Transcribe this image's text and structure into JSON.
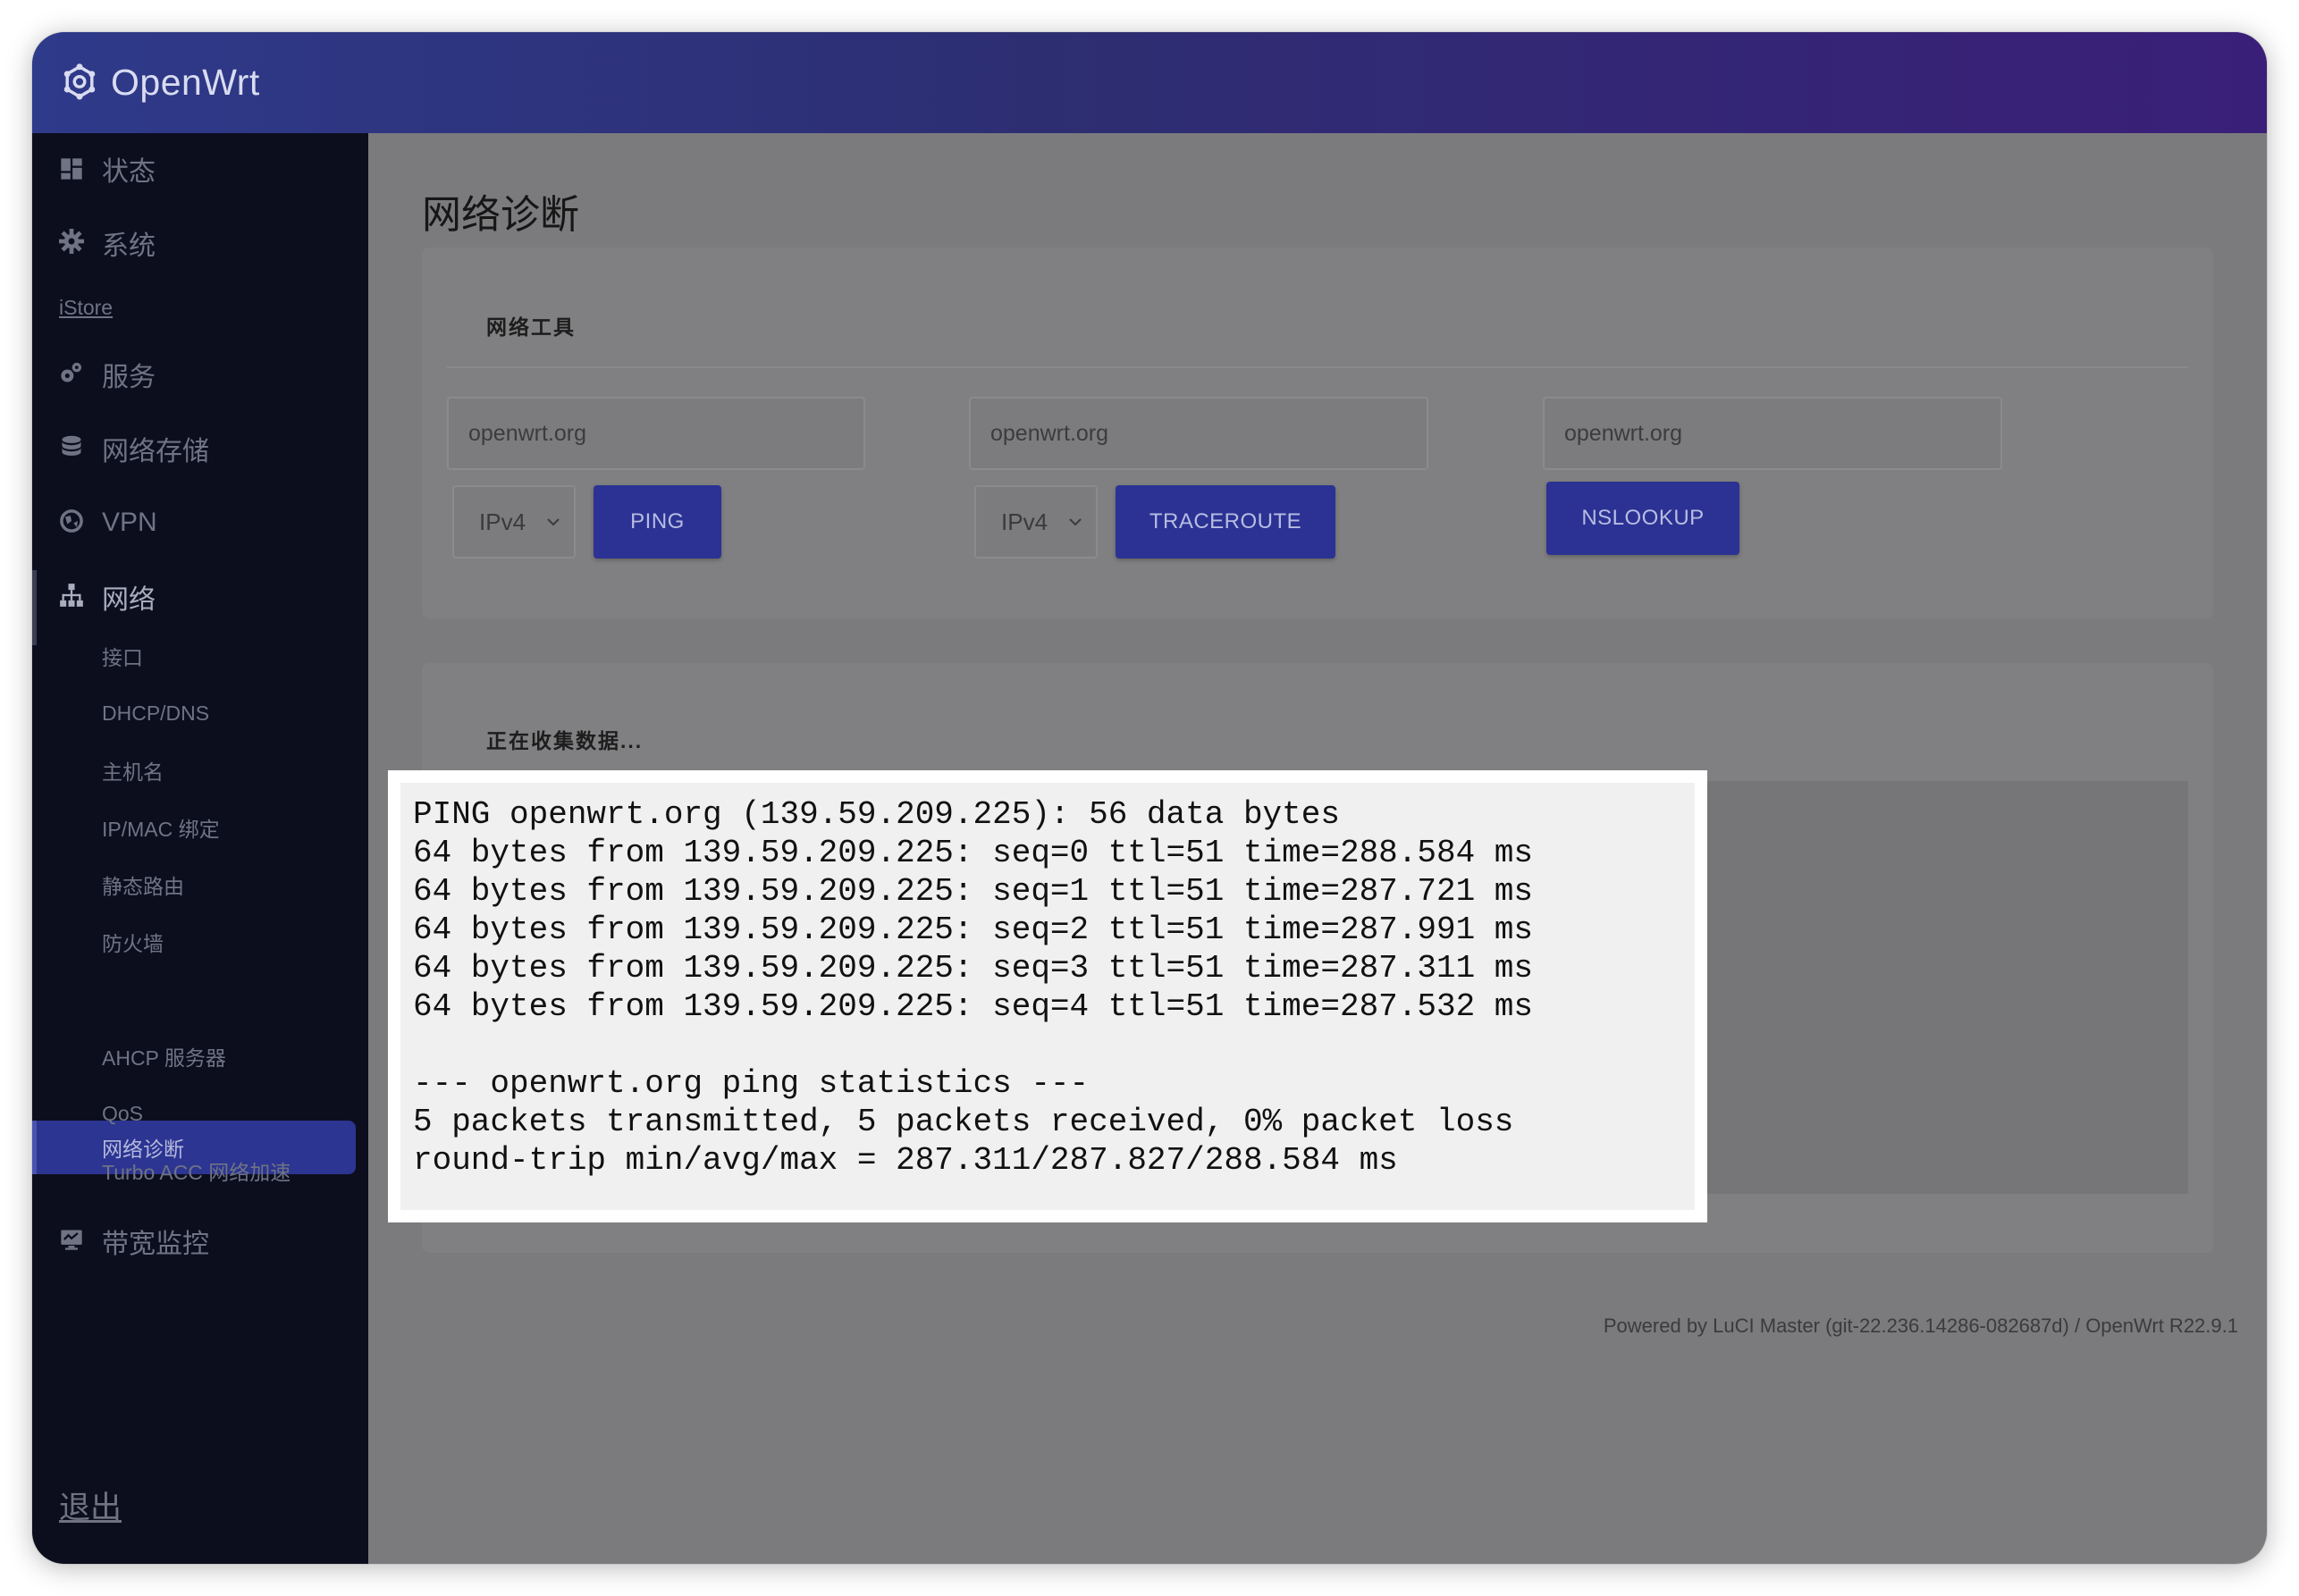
{
  "brand": "OpenWrt",
  "sidebar": {
    "top": [
      {
        "label": "状态",
        "icon": "dashboard-icon"
      },
      {
        "label": "系统",
        "icon": "gear-icon"
      }
    ],
    "istore": "iStore",
    "mid": [
      {
        "label": "服务",
        "icon": "cogs-icon"
      },
      {
        "label": "网络存储",
        "icon": "database-icon"
      },
      {
        "label": "VPN",
        "icon": "globe-icon"
      },
      {
        "label": "网络",
        "icon": "sitemap-icon"
      }
    ],
    "network_sub": [
      "接口",
      "DHCP/DNS",
      "主机名",
      "IP/MAC 绑定",
      "静态路由",
      "防火墙",
      "网络诊断",
      "AHCP 服务器",
      "QoS",
      "Turbo ACC 网络加速"
    ],
    "bandwidth": {
      "label": "带宽监控",
      "icon": "monitor-icon"
    },
    "logout": "退出"
  },
  "main": {
    "page_title": "网络诊断",
    "tools_title": "网络工具",
    "ping": {
      "host": "openwrt.org",
      "family": "IPv4",
      "button": "PING"
    },
    "traceroute": {
      "host": "openwrt.org",
      "family": "IPv4",
      "button": "TRACEROUTE"
    },
    "nslookup": {
      "host": "openwrt.org",
      "button": "NSLOOKUP"
    },
    "collecting": "正在收集数据...",
    "output": "PING openwrt.org (139.59.209.225): 56 data bytes\n64 bytes from 139.59.209.225: seq=0 ttl=51 time=288.584 ms\n64 bytes from 139.59.209.225: seq=1 ttl=51 time=287.721 ms\n64 bytes from 139.59.209.225: seq=2 ttl=51 time=287.991 ms\n64 bytes from 139.59.209.225: seq=3 ttl=51 time=287.311 ms\n64 bytes from 139.59.209.225: seq=4 ttl=51 time=287.532 ms\n\n--- openwrt.org ping statistics ---\n5 packets transmitted, 5 packets received, 0% packet loss\nround-trip min/avg/max = 287.311/287.827/288.584 ms"
  },
  "footer": "Powered by LuCI Master (git-22.236.14286-082687d) / OpenWrt R22.9.1",
  "colors": {
    "header_start": "#2e3a8a",
    "header_end": "#3a1f78",
    "sidebar_bg": "#0c0e1e",
    "accent": "#2c3592",
    "button": "#2b3293"
  }
}
